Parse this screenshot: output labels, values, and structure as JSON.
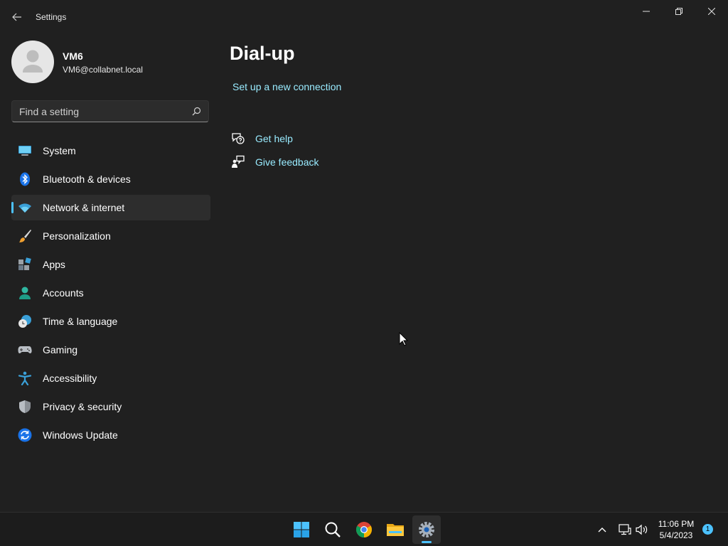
{
  "window": {
    "title": "Settings"
  },
  "profile": {
    "name": "VM6",
    "email": "VM6@collabnet.local"
  },
  "search": {
    "placeholder": "Find a setting"
  },
  "nav": {
    "items": [
      {
        "label": "System",
        "icon": "system-icon"
      },
      {
        "label": "Bluetooth & devices",
        "icon": "bluetooth-icon"
      },
      {
        "label": "Network & internet",
        "icon": "wifi-icon",
        "selected": true
      },
      {
        "label": "Personalization",
        "icon": "brush-icon"
      },
      {
        "label": "Apps",
        "icon": "apps-icon"
      },
      {
        "label": "Accounts",
        "icon": "person-icon"
      },
      {
        "label": "Time & language",
        "icon": "clock-globe-icon"
      },
      {
        "label": "Gaming",
        "icon": "gamepad-icon"
      },
      {
        "label": "Accessibility",
        "icon": "accessibility-icon"
      },
      {
        "label": "Privacy & security",
        "icon": "shield-icon"
      },
      {
        "label": "Windows Update",
        "icon": "update-icon"
      }
    ]
  },
  "main": {
    "title": "Dial-up",
    "setup_link": "Set up a new connection",
    "get_help": "Get help",
    "give_feedback": "Give feedback"
  },
  "taskbar": {
    "apps": [
      "start-icon",
      "search-icon",
      "chrome-icon",
      "file-explorer-icon",
      "settings-icon"
    ],
    "active_app": "settings-icon"
  },
  "tray": {
    "time": "11:06 PM",
    "date": "5/4/2023",
    "notification_count": "1"
  },
  "colors": {
    "background": "#202020",
    "accent": "#4cc2ff",
    "link": "#99ebff",
    "selected_item": "#2d2d2d"
  }
}
